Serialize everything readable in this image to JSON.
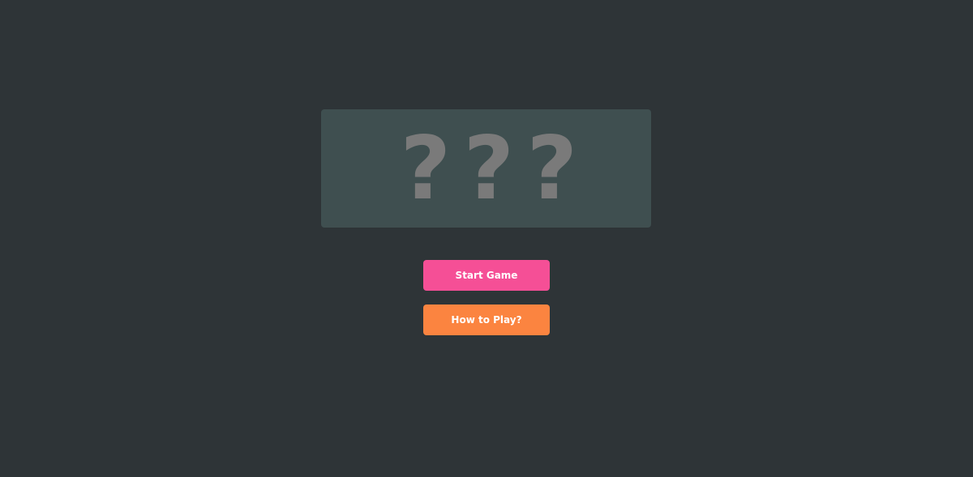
{
  "secret_code": {
    "slots": [
      "?",
      "?",
      "?"
    ]
  },
  "menu": {
    "start_label": "Start Game",
    "howto_label": "How to Play?"
  },
  "colors": {
    "background": "#2e3437",
    "panel": "#3f4f50",
    "placeholder": "#7a7a7a",
    "start_button": "#f54f96",
    "howto_button": "#fb8440",
    "button_text": "#ffffff"
  }
}
